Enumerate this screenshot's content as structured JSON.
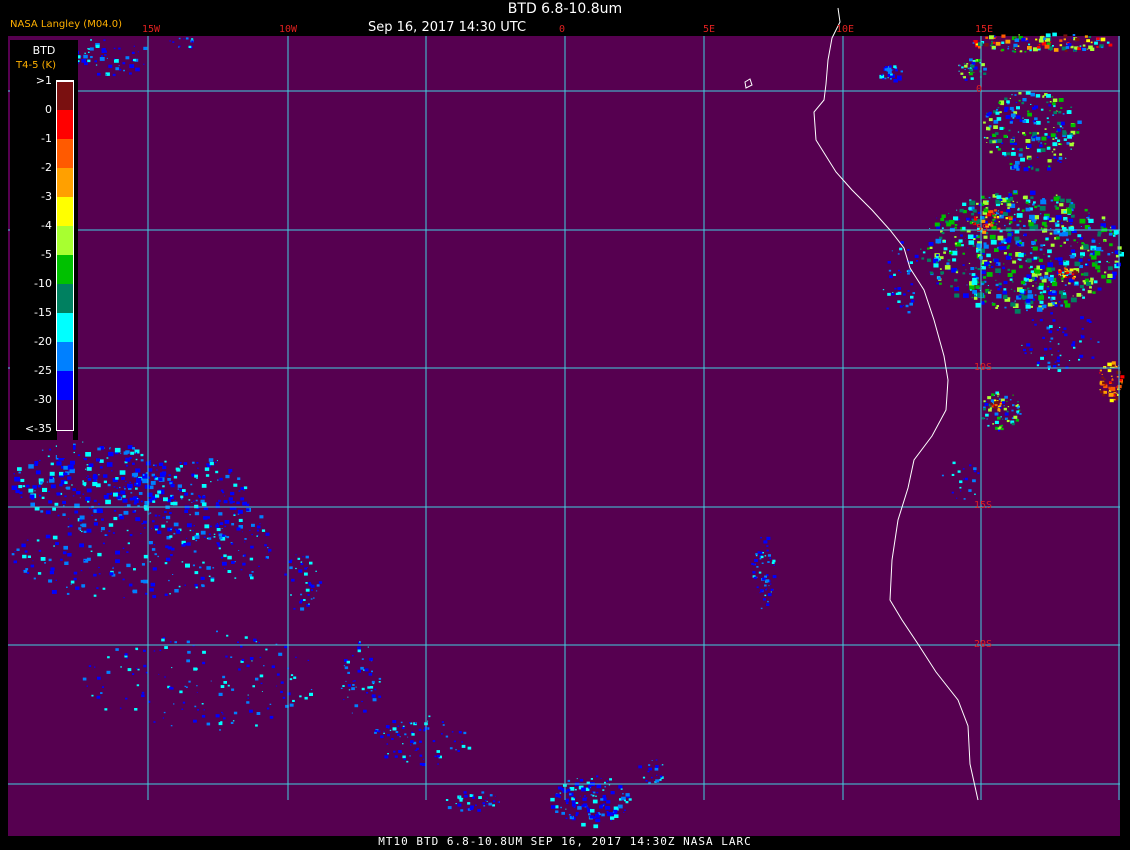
{
  "header": {
    "title": "BTD 6.8-10.8um",
    "subtitle": "Sep 16, 2017 14:30 UTC",
    "agency": "NASA Langley (M04.0)"
  },
  "footer": "MT10  BTD 6.8-10.8UM   SEP 16, 2017 14:30Z   NASA LARC",
  "legend": {
    "title": "BTD",
    "subtitle": "T4-5 (K)",
    "items": [
      {
        "label": ">1",
        "color": "#7a1010"
      },
      {
        "label": "0",
        "color": "#ff0000"
      },
      {
        "label": "-1",
        "color": "#ff5a00"
      },
      {
        "label": "-2",
        "color": "#ffa000"
      },
      {
        "label": "-3",
        "color": "#ffff00"
      },
      {
        "label": "-4",
        "color": "#a8ff30"
      },
      {
        "label": "-5",
        "color": "#00c000"
      },
      {
        "label": "-10",
        "color": "#008060"
      },
      {
        "label": "-15",
        "color": "#00ffff"
      },
      {
        "label": "-20",
        "color": "#0080ff"
      },
      {
        "label": "-25",
        "color": "#0000ff"
      },
      {
        "label": "-30",
        "color": "#560050"
      },
      {
        "label": "<-35",
        "color": "#560050"
      }
    ]
  },
  "longitude_labels": [
    "15W",
    "10W",
    "0",
    "5E",
    "10E",
    "15E"
  ],
  "latitude_labels": [
    "0",
    "5S",
    "10S",
    "15S",
    "20S"
  ],
  "colors": {
    "background": "#560050",
    "grid": "#40d0e0",
    "coast": "#ffffff",
    "label": "#e02020"
  }
}
